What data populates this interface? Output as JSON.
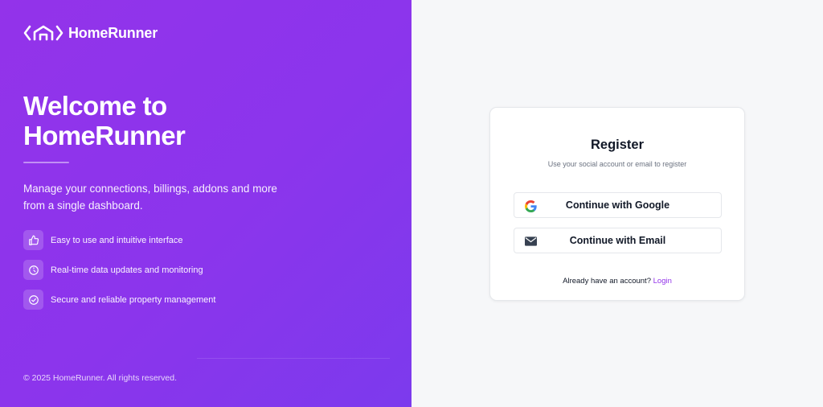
{
  "brand": {
    "name": "HomeRunner"
  },
  "hero": {
    "title_line1": "Welcome to",
    "title_line2": "HomeRunner",
    "description": "Manage your connections, billings, addons and more from a single dashboard."
  },
  "features": [
    {
      "icon": "thumbs-up-icon",
      "label": "Easy to use and intuitive interface"
    },
    {
      "icon": "gauge-icon",
      "label": "Real-time data updates and monitoring"
    },
    {
      "icon": "check-circle-icon",
      "label": "Secure and reliable property management"
    }
  ],
  "footer": {
    "copyright": "© 2025 HomeRunner. All rights reserved."
  },
  "register": {
    "title": "Register",
    "subtitle": "Use your social account or email to register",
    "google_label": "Continue with Google",
    "email_label": "Continue with Email",
    "already_text": "Already have an account?",
    "login_link": "Login"
  },
  "colors": {
    "brand_purple": "#9333ea",
    "panel_bg": "#f6f7f9",
    "text_dark": "#111827"
  }
}
